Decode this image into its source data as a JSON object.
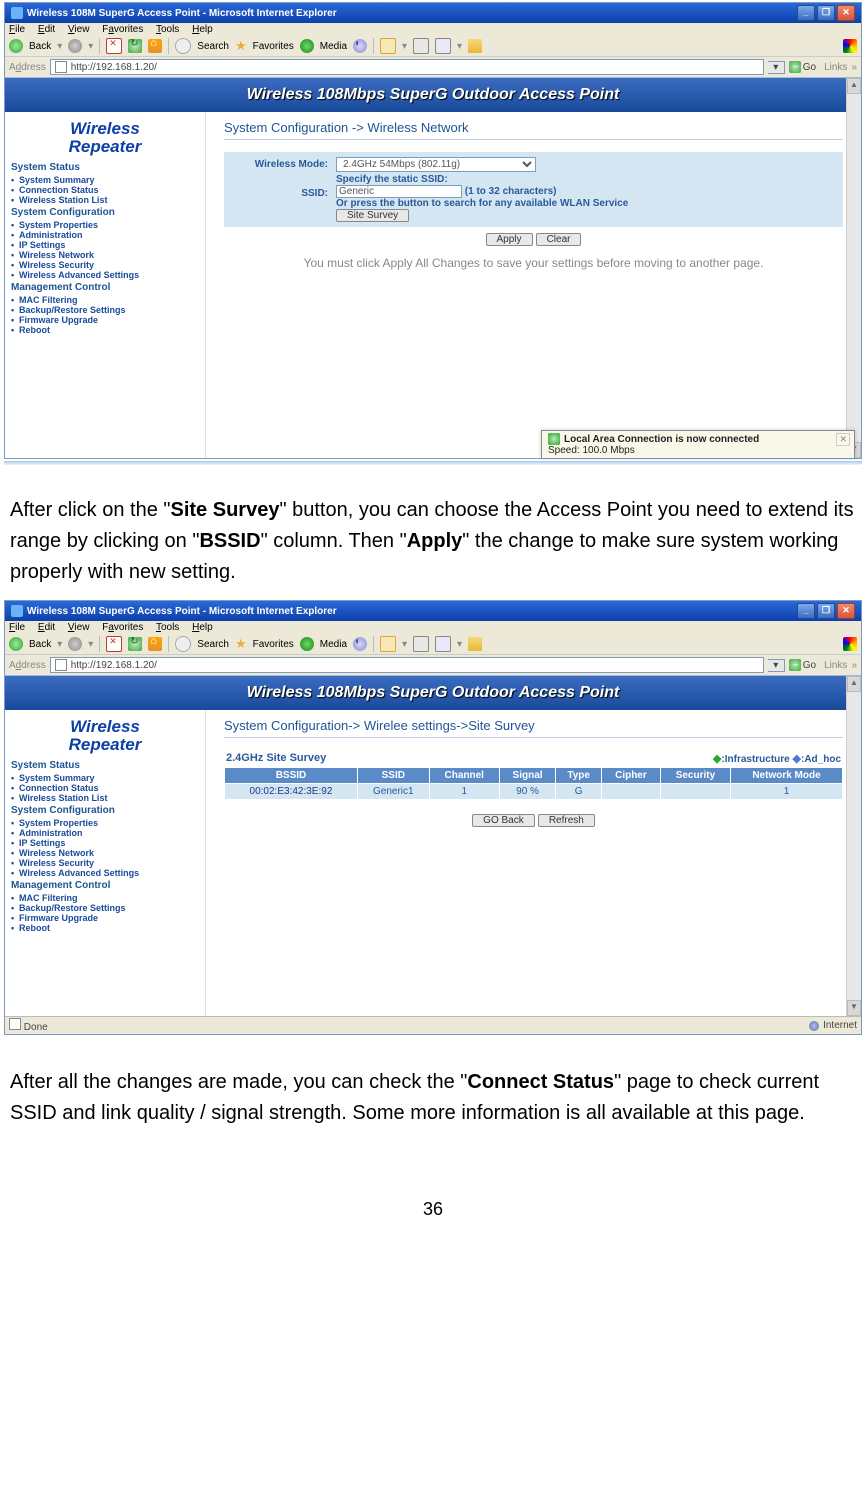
{
  "browser": {
    "title": "Wireless 108M SuperG Access Point - Microsoft Internet Explorer",
    "menus": {
      "file": "File",
      "edit": "Edit",
      "view": "View",
      "favorites": "Favorites",
      "tools": "Tools",
      "help": "Help"
    },
    "toolbar": {
      "back": "Back",
      "search": "Search",
      "favorites": "Favorites",
      "media": "Media"
    },
    "address_label": "Address",
    "url": "http://192.168.1.20/",
    "go": "Go",
    "links": "Links",
    "status_done": "Done",
    "status_internet": "Internet"
  },
  "banner": "Wireless 108Mbps SuperG Outdoor Access Point",
  "sidebar": {
    "title_1": "Wireless",
    "title_2": "Repeater",
    "groups": [
      {
        "head": "System Status",
        "items": [
          "System Summary",
          "Connection Status",
          "Wireless Station List"
        ]
      },
      {
        "head": "System Configuration",
        "items": [
          "System Properties",
          "Administration",
          "IP Settings",
          "Wireless Network",
          "Wireless Security",
          "Wireless Advanced Settings"
        ]
      },
      {
        "head": "Management Control",
        "items": [
          "MAC Filtering",
          "Backup/Restore Settings",
          "Firmware Upgrade",
          "Reboot"
        ]
      }
    ]
  },
  "page1": {
    "breadcrumb": "System Configuration -> Wireless Network",
    "wireless_mode_label": "Wireless Mode:",
    "wireless_mode_value": "2.4GHz 54Mbps (802.11g)",
    "ssid_label": "SSID:",
    "specify_text": "Specify the static SSID:",
    "ssid_value": "Generic",
    "ssid_hint": "(1 to 32 characters)",
    "or_text": "Or press the button to search for any available WLAN Service",
    "site_survey_btn": "Site Survey",
    "apply_btn": "Apply",
    "clear_btn": "Clear",
    "note": "You must click Apply All Changes to save your settings before moving to another page."
  },
  "notif": {
    "title": "Local Area Connection is now connected",
    "speed": "Speed: 100.0 Mbps"
  },
  "page2": {
    "breadcrumb": "System Configuration-> Wirelee settings->Site Survey",
    "survey_title": "2.4GHz Site Survey",
    "legend_infra": ":Infrastructure",
    "legend_adhoc": ":Ad_hoc",
    "cols": [
      "BSSID",
      "SSID",
      "Channel",
      "Signal",
      "Type",
      "Cipher",
      "Security",
      "Network Mode"
    ],
    "row": {
      "bssid": "00:02:E3:42:3E:92",
      "ssid": "Generic1",
      "channel": "1",
      "signal": "90 %",
      "type": "G",
      "cipher": "",
      "security": "",
      "mode": "1"
    },
    "go_back_btn": "GO Back",
    "refresh_btn": "Refresh"
  },
  "para1": {
    "t1": "After click on the \"",
    "b1": "Site Survey",
    "t2": "\" button, you can choose the Access Point you need to extend its range by clicking on \"",
    "b2": "BSSID",
    "t3": "\" column. Then \"",
    "b3": "Apply",
    "t4": "\" the change to make sure system working properly with new setting."
  },
  "para2": {
    "t1": "After all the changes are made, you can check the \"",
    "b1": "Connect Status",
    "t2": "\" page to check current SSID and link quality / signal strength. Some more information is all available at this page."
  },
  "pagenum": "36"
}
